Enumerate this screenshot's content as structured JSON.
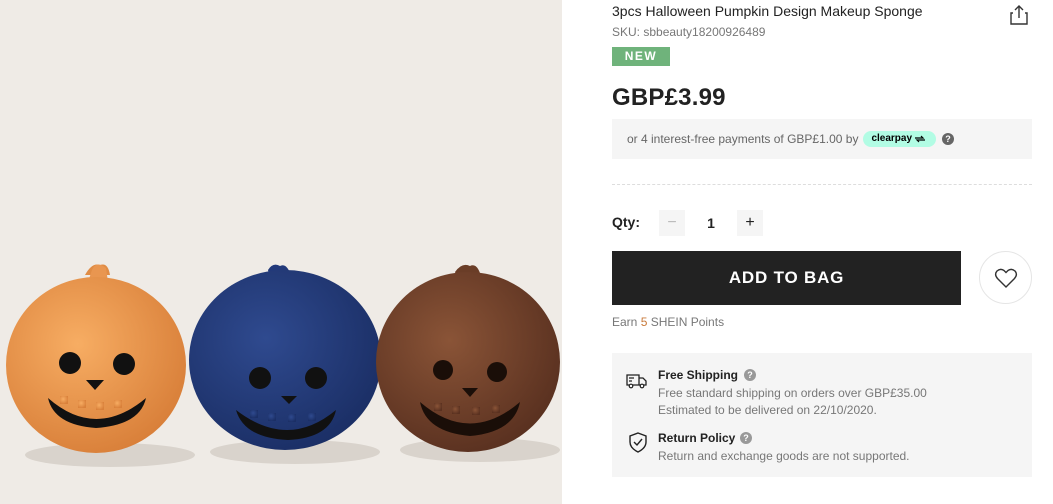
{
  "product": {
    "title": "3pcs Halloween Pumpkin Design Makeup Sponge",
    "sku": "SKU: sbbeauty18200926489",
    "badge": "NEW",
    "price": "GBP£3.99",
    "image_icon": "pumpkin-sponges-photo"
  },
  "installment": {
    "text": "or 4 interest-free payments of GBP£1.00 by",
    "provider": "clearpay",
    "help": "?"
  },
  "quantity": {
    "label": "Qty:",
    "minus": "−",
    "value": "1",
    "plus": "+"
  },
  "actions": {
    "add_to_bag": "ADD TO BAG",
    "share_icon": "share-icon",
    "wishlist_icon": "heart-icon"
  },
  "points": {
    "prefix": "Earn ",
    "value": "5",
    "suffix": " SHEIN Points"
  },
  "services": {
    "shipping": {
      "icon": "truck-icon",
      "title": "Free Shipping",
      "help": "?",
      "lines": [
        "Free standard shipping on orders over GBP£35.00",
        "Estimated to be delivered on 22/10/2020."
      ]
    },
    "returns": {
      "icon": "shield-check-icon",
      "title": "Return Policy",
      "help": "?",
      "lines": [
        "Return and exchange goods are not supported."
      ]
    }
  },
  "colors": {
    "badge_green": "#6fb37b",
    "button_black": "#222222",
    "clearpay_mint": "#b2fce4",
    "points_orange": "#c87a3b"
  }
}
